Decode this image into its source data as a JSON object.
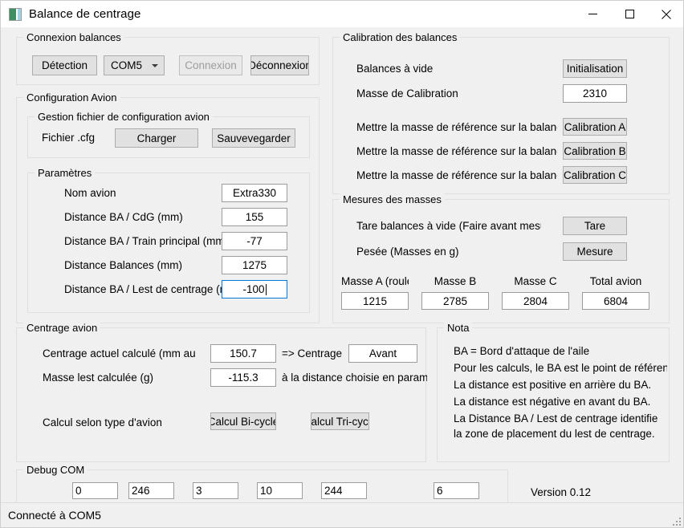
{
  "window": {
    "title": "Balance de centrage",
    "icon": "app-window-icon",
    "minimize": "minimize-icon",
    "maximize": "maximize-icon",
    "close": "close-icon"
  },
  "statusbar": {
    "text": "Connecté à COM5"
  },
  "connexion": {
    "legend": "Connexion balances",
    "detection_button": "Détection",
    "port_selected": "COM5",
    "connexion_button": "Connexion",
    "deconnexion_button": "Déconnexion"
  },
  "configuration": {
    "legend": "Configuration Avion",
    "gestion": {
      "legend": "Gestion fichier de configuration avion",
      "fichier_label": "Fichier .cfg",
      "charger_button": "Charger",
      "sauvegarder_button": "Sauvevegarder"
    },
    "parametres": {
      "legend": "Paramètres",
      "rows": [
        {
          "label": "Nom avion",
          "value": "Extra330"
        },
        {
          "label": "Distance BA / CdG (mm)",
          "value": "155"
        },
        {
          "label": "Distance BA / Train principal (mm)",
          "value": "-77"
        },
        {
          "label": "Distance Balances (mm)",
          "value": "1275"
        },
        {
          "label": "Distance BA / Lest de centrage (mm)",
          "value": "-100"
        }
      ]
    }
  },
  "calibration": {
    "legend": "Calibration des balances",
    "balances_vide_label": "Balances à vide",
    "initialisation_button": "Initialisation",
    "masse_calibration_label": "Masse de Calibration",
    "masse_calibration_value": "2310",
    "rows": [
      {
        "label": "Mettre la masse de référence sur la balance A",
        "button": "Calibration A"
      },
      {
        "label": "Mettre la masse de référence sur la balance B",
        "button": "Calibration B"
      },
      {
        "label": "Mettre la masse de référence sur la balance C",
        "button": "Calibration C"
      }
    ]
  },
  "mesures": {
    "legend": "Mesures des masses",
    "tare_label": "Tare balances à vide (Faire avant mesure)",
    "tare_button": "Tare",
    "pesee_label": "Pesée (Masses en g)",
    "mesure_button": "Mesure",
    "columns": [
      {
        "header": "Masse A (roulette)",
        "value": "1215"
      },
      {
        "header": "Masse B",
        "value": "2785"
      },
      {
        "header": "Masse C",
        "value": "2804"
      },
      {
        "header": "Total avion",
        "value": "6804"
      }
    ]
  },
  "centrage": {
    "legend": "Centrage avion",
    "actuel_label": "Centrage actuel calculé (mm au BA)",
    "actuel_value": "150.7",
    "arrow_label": "=> Centrage",
    "arrow_value": "Avant",
    "lest_label": "Masse lest calculée (g)",
    "lest_value": "-115.3",
    "lest_suffix": "à la distance choisie en paramètre",
    "type_label": "Calcul selon type d'avion",
    "bicycle_button": "Calcul Bi-cycle",
    "tricycle_button": "Calcul Tri-cycle"
  },
  "nota": {
    "legend": "Nota",
    "lines": [
      "BA = Bord d'attaque de l'aile",
      "Pour les calculs, le BA est le  point de référence",
      "La distance est positive en arrière du BA.",
      "La distance est négative en avant du BA.",
      "La Distance BA / Lest de centrage identifie",
      "la zone de placement du lest de centrage."
    ]
  },
  "debug": {
    "legend": "Debug COM",
    "fields": [
      "0",
      "246",
      "3",
      "10",
      "244",
      "6"
    ],
    "version": "Version 0.12"
  }
}
